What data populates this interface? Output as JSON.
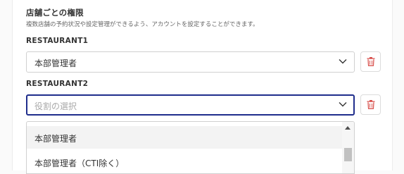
{
  "permissions": {
    "title": "店舗ごとの権限",
    "description": "複数店舗の予約状況や設定管理ができるよう、アカウントを設定することができます。"
  },
  "restaurants": [
    {
      "label": "RESTAURANT1",
      "selected": "本部管理者"
    },
    {
      "label": "RESTAURANT2",
      "placeholder": "役割の選択"
    }
  ],
  "dropdown": {
    "options": [
      "本部管理者",
      "本部管理者（CTI除く）"
    ]
  },
  "icons": {
    "chevron": "chevron-down-icon",
    "delete": "trash-icon",
    "scroll_up": "scroll-up-arrow-icon"
  },
  "colors": {
    "focus_border": "#1f2d8c",
    "delete_icon": "#d9534f"
  }
}
